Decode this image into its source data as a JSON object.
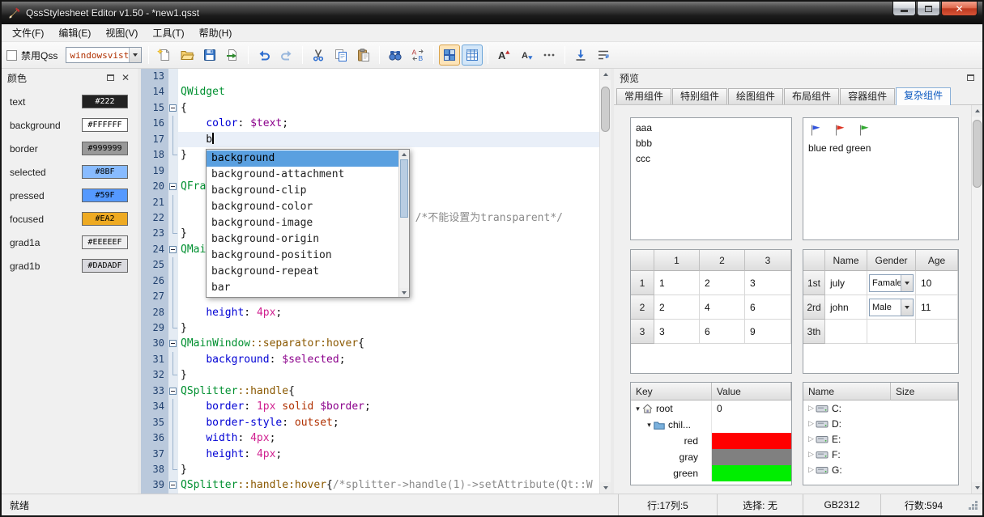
{
  "window": {
    "title": "QssStylesheet Editor v1.50 - *new1.qsst"
  },
  "menu": {
    "items": [
      {
        "label": "文件(F)"
      },
      {
        "label": "编辑(E)"
      },
      {
        "label": "视图(V)"
      },
      {
        "label": "工具(T)"
      },
      {
        "label": "帮助(H)"
      }
    ]
  },
  "toolbar": {
    "disable_qss_label": "禁用Qss",
    "theme_combo_value": "windowsvist",
    "icon_groups": [
      [
        {
          "name": "new-file"
        },
        {
          "name": "open-file"
        },
        {
          "name": "save-file"
        },
        {
          "name": "export-qss"
        }
      ],
      [
        {
          "name": "undo"
        },
        {
          "name": "redo",
          "disabled": true
        }
      ],
      [
        {
          "name": "cut"
        },
        {
          "name": "copy"
        },
        {
          "name": "paste"
        }
      ],
      [
        {
          "name": "find"
        },
        {
          "name": "replace"
        }
      ],
      [
        {
          "name": "color-grid",
          "highlight": "orange"
        },
        {
          "name": "color-table",
          "highlight": "blue"
        }
      ],
      [
        {
          "name": "font-increase"
        },
        {
          "name": "font-decrease"
        },
        {
          "name": "more-options"
        }
      ],
      [
        {
          "name": "goto-line"
        },
        {
          "name": "word-wrap"
        }
      ]
    ]
  },
  "colors_panel": {
    "title": "颜色",
    "items": [
      {
        "name": "text",
        "hex": "#222",
        "swatch": "#222222",
        "text_color": "#ffffff"
      },
      {
        "name": "background",
        "hex": "#FFFFFF",
        "swatch": "#ffffff",
        "text_color": "#000000"
      },
      {
        "name": "border",
        "hex": "#999999",
        "swatch": "#999999",
        "text_color": "#000000"
      },
      {
        "name": "selected",
        "hex": "#8BF",
        "swatch": "#88bbff",
        "text_color": "#000000"
      },
      {
        "name": "pressed",
        "hex": "#59F",
        "swatch": "#5599ff",
        "text_color": "#000000"
      },
      {
        "name": "focused",
        "hex": "#EA2",
        "swatch": "#eeaa22",
        "text_color": "#000000"
      },
      {
        "name": "grad1a",
        "hex": "#EEEEEF",
        "swatch": "#eeeeef",
        "text_color": "#000000"
      },
      {
        "name": "grad1b",
        "hex": "#DADADF",
        "swatch": "#dadadf",
        "text_color": "#000000"
      }
    ]
  },
  "editor": {
    "lines": [
      {
        "n": 13,
        "segs": []
      },
      {
        "n": 14,
        "segs": [
          {
            "t": "QWidget",
            "c": "cls"
          }
        ]
      },
      {
        "n": 15,
        "fold": "open",
        "segs": [
          {
            "t": "{",
            "c": "pun"
          }
        ]
      },
      {
        "n": 16,
        "fold": "line",
        "segs": [
          {
            "t": "    ",
            "c": "pln"
          },
          {
            "t": "color",
            "c": "prop"
          },
          {
            "t": ": ",
            "c": "pun"
          },
          {
            "t": "$text",
            "c": "var"
          },
          {
            "t": ";",
            "c": "pun"
          }
        ]
      },
      {
        "n": 17,
        "fold": "line",
        "current": true,
        "cursor": true,
        "segs": [
          {
            "t": "    b",
            "c": "pln"
          }
        ]
      },
      {
        "n": 18,
        "fold": "end",
        "segs": [
          {
            "t": "}",
            "c": "pun"
          }
        ]
      },
      {
        "n": 19,
        "segs": []
      },
      {
        "n": 20,
        "fold": "open",
        "segs": [
          {
            "t": "QFra",
            "c": "cls"
          }
        ]
      },
      {
        "n": 21,
        "fold": "line",
        "segs": []
      },
      {
        "n": 22,
        "fold": "line",
        "segs": [
          {
            "t": "                                     ",
            "c": "pln"
          },
          {
            "t": "/*不能设置为transparent*/",
            "c": "cmt"
          }
        ]
      },
      {
        "n": 23,
        "fold": "end",
        "segs": [
          {
            "t": "}",
            "c": "pun"
          }
        ]
      },
      {
        "n": 24,
        "fold": "open",
        "segs": [
          {
            "t": "QMai",
            "c": "cls"
          }
        ]
      },
      {
        "n": 25,
        "fold": "line",
        "segs": []
      },
      {
        "n": 26,
        "fold": "line",
        "segs": []
      },
      {
        "n": 27,
        "fold": "line",
        "segs": []
      },
      {
        "n": 28,
        "fold": "line",
        "segs": [
          {
            "t": "    ",
            "c": "pln"
          },
          {
            "t": "height",
            "c": "prop"
          },
          {
            "t": ": ",
            "c": "pun"
          },
          {
            "t": "4px",
            "c": "num"
          },
          {
            "t": ";",
            "c": "pun"
          }
        ]
      },
      {
        "n": 29,
        "fold": "end",
        "segs": [
          {
            "t": "}",
            "c": "pun"
          }
        ]
      },
      {
        "n": 30,
        "fold": "open",
        "segs": [
          {
            "t": "QMainWindow",
            "c": "cls"
          },
          {
            "t": "::separator:hover",
            "c": "pse"
          },
          {
            "t": "{",
            "c": "pun"
          }
        ]
      },
      {
        "n": 31,
        "fold": "line",
        "segs": [
          {
            "t": "    ",
            "c": "pln"
          },
          {
            "t": "background",
            "c": "prop"
          },
          {
            "t": ": ",
            "c": "pun"
          },
          {
            "t": "$selected",
            "c": "var"
          },
          {
            "t": ";",
            "c": "pun"
          }
        ]
      },
      {
        "n": 32,
        "fold": "end",
        "segs": [
          {
            "t": "}",
            "c": "pun"
          }
        ]
      },
      {
        "n": 33,
        "fold": "open",
        "segs": [
          {
            "t": "QSplitter",
            "c": "cls"
          },
          {
            "t": "::handle",
            "c": "pse"
          },
          {
            "t": "{",
            "c": "pun"
          }
        ]
      },
      {
        "n": 34,
        "fold": "line",
        "segs": [
          {
            "t": "    ",
            "c": "pln"
          },
          {
            "t": "border",
            "c": "prop"
          },
          {
            "t": ": ",
            "c": "pun"
          },
          {
            "t": "1px",
            "c": "num"
          },
          {
            "t": " ",
            "c": "pln"
          },
          {
            "t": "solid",
            "c": "val"
          },
          {
            "t": " ",
            "c": "pln"
          },
          {
            "t": "$border",
            "c": "var"
          },
          {
            "t": ";",
            "c": "pun"
          }
        ]
      },
      {
        "n": 35,
        "fold": "line",
        "segs": [
          {
            "t": "    ",
            "c": "pln"
          },
          {
            "t": "border-style",
            "c": "prop"
          },
          {
            "t": ": ",
            "c": "pun"
          },
          {
            "t": "outset",
            "c": "val"
          },
          {
            "t": ";",
            "c": "pun"
          }
        ]
      },
      {
        "n": 36,
        "fold": "line",
        "segs": [
          {
            "t": "    ",
            "c": "pln"
          },
          {
            "t": "width",
            "c": "prop"
          },
          {
            "t": ": ",
            "c": "pun"
          },
          {
            "t": "4px",
            "c": "num"
          },
          {
            "t": ";",
            "c": "pun"
          }
        ]
      },
      {
        "n": 37,
        "fold": "line",
        "segs": [
          {
            "t": "    ",
            "c": "pln"
          },
          {
            "t": "height",
            "c": "prop"
          },
          {
            "t": ": ",
            "c": "pun"
          },
          {
            "t": "4px",
            "c": "num"
          },
          {
            "t": ";",
            "c": "pun"
          }
        ]
      },
      {
        "n": 38,
        "fold": "end",
        "segs": [
          {
            "t": "}",
            "c": "pun"
          }
        ]
      },
      {
        "n": 39,
        "fold": "open",
        "segs": [
          {
            "t": "QSplitter",
            "c": "cls"
          },
          {
            "t": "::handle:hover",
            "c": "pse"
          },
          {
            "t": "{",
            "c": "pun"
          },
          {
            "t": "/*splitter->handle(1)->setAttribute(Qt::W",
            "c": "cmt"
          }
        ]
      }
    ],
    "autocomplete": {
      "items": [
        "background",
        "background-attachment",
        "background-clip",
        "background-color",
        "background-image",
        "background-origin",
        "background-position",
        "background-repeat",
        "bar"
      ],
      "selected_index": 0
    }
  },
  "preview": {
    "title": "预览",
    "tabs": [
      {
        "label": "常用组件"
      },
      {
        "label": "特别组件"
      },
      {
        "label": "绘图组件"
      },
      {
        "label": "布局组件"
      },
      {
        "label": "容器组件"
      },
      {
        "label": "复杂组件",
        "active": true
      }
    ],
    "list_items": [
      "aaa",
      "bbb",
      "ccc"
    ],
    "flags": {
      "colors": [
        "#3355dd",
        "#dd3322",
        "#33aa33"
      ],
      "label": "blue red green"
    },
    "mult_table": {
      "col_headers": [
        "1",
        "2",
        "3"
      ],
      "row_headers": [
        "1",
        "2",
        "3"
      ],
      "rows": [
        [
          "1",
          "2",
          "3"
        ],
        [
          "2",
          "4",
          "6"
        ],
        [
          "3",
          "6",
          "9"
        ]
      ]
    },
    "person_table": {
      "col_headers": [
        "Name",
        "Gender",
        "Age"
      ],
      "row_headers": [
        "1st",
        "2rd",
        "3th"
      ],
      "rows": [
        [
          "july",
          "Famale",
          "10"
        ],
        [
          "john",
          "Male",
          "11"
        ],
        [
          "",
          "",
          ""
        ]
      ]
    },
    "kv_tree": {
      "headers": [
        "Key",
        "Value"
      ],
      "rows": [
        {
          "key": "root",
          "value": "0",
          "icon": "home",
          "level": 0,
          "expanded": true
        },
        {
          "key": "chil...",
          "value": "",
          "icon": "folder",
          "level": 1,
          "expanded": true
        },
        {
          "key": "red",
          "value_color": "#ff0000",
          "level": 2
        },
        {
          "key": "gray",
          "value_color": "#808080",
          "level": 2
        },
        {
          "key": "green",
          "value_color": "#00ee00",
          "level": 2
        }
      ]
    },
    "drive_tree": {
      "headers": [
        "Name",
        "Size"
      ],
      "rows": [
        {
          "name": "C:"
        },
        {
          "name": "D:"
        },
        {
          "name": "E:"
        },
        {
          "name": "F:"
        },
        {
          "name": "G:"
        }
      ]
    }
  },
  "statusbar": {
    "ready": "就绪",
    "cursor": "行:17列:5",
    "selection": "选择: 无",
    "encoding": "GB2312",
    "lines": "行数:594"
  }
}
